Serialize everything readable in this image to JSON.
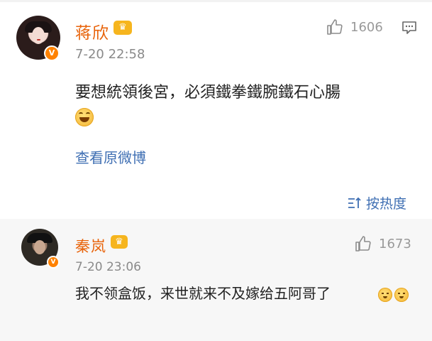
{
  "post": {
    "author": "蒋欣",
    "verified_badge": "V",
    "vip_crown_icon": "crown-icon",
    "time": "7-20 22:58",
    "likes": "1606",
    "content": "要想統領後宮，必須鐵拳鐵腕鐵石心腸",
    "emoji_icon": "laughing-tears-emoji",
    "view_original": "查看原微博",
    "sort_label": "按热度"
  },
  "reply": {
    "author": "秦岚",
    "verified_badge": "V",
    "vip_crown_icon": "crown-icon",
    "time": "7-20 23:06",
    "likes": "1673",
    "content": "我不领盒饭，来世就来不及嫁给五阿哥了",
    "emoji_icon": "upside-down-face-emoji"
  },
  "colors": {
    "name": "#e8630a",
    "link": "#3f6fb3",
    "badge": "#ff8200",
    "crown": "#f6b51e",
    "reply_bg": "#f7f7f7"
  }
}
